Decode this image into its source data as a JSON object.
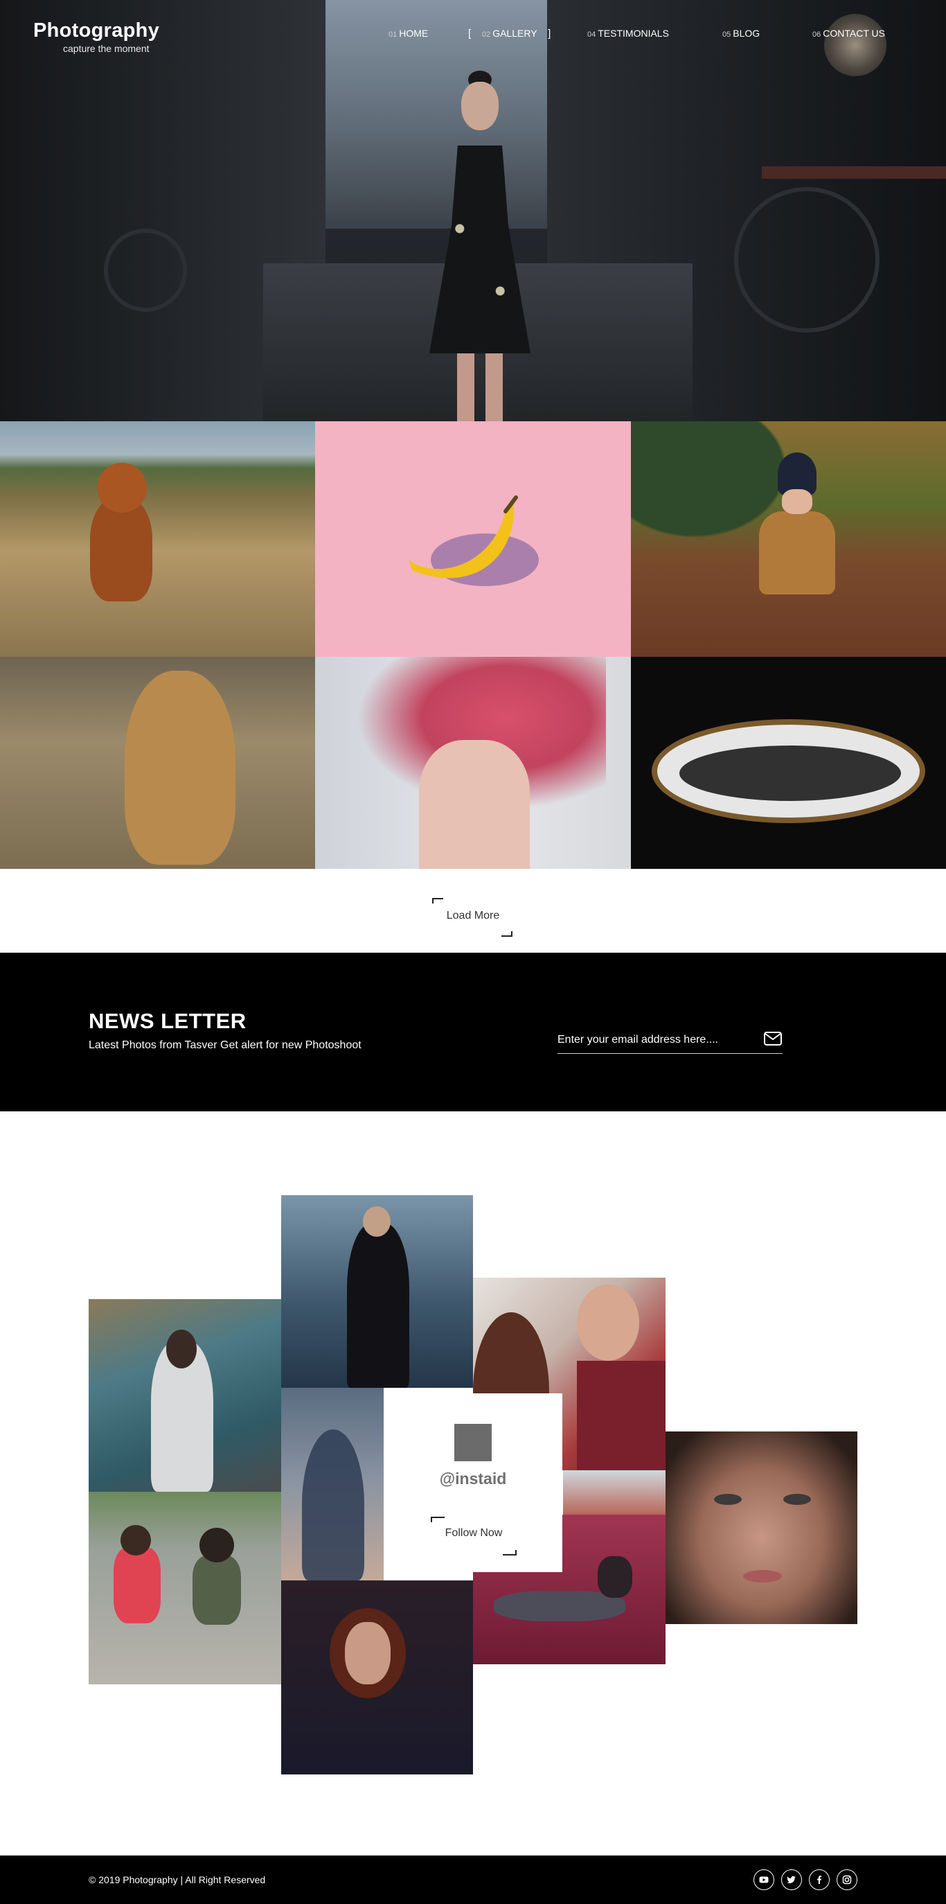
{
  "brand": {
    "title": "Photography",
    "tagline": "capture the moment"
  },
  "nav": {
    "items": [
      {
        "num": "01",
        "label": "HOME"
      },
      {
        "num": "02",
        "label": "GALLERY",
        "bracket_open": "[",
        "bracket_close": "]"
      },
      {
        "num": "04",
        "label": "TESTIMONIALS"
      },
      {
        "num": "05",
        "label": "BLOG"
      },
      {
        "num": "06",
        "label": "CONTACT US"
      }
    ]
  },
  "gallery": {
    "load_more": "Load More"
  },
  "newsletter": {
    "title": "NEWS LETTER",
    "subtitle": "Latest Photos from Tasver Get alert for new Photoshoot",
    "placeholder": "Enter your email address here....",
    "send_icon": "envelope-icon"
  },
  "instagram": {
    "handle": "@instaid",
    "follow_label": "Follow Now",
    "logo_icon": "instagram-logo-icon"
  },
  "footer": {
    "copyright": "© 2019 Photography | All Right Reserved",
    "socials": [
      "youtube-icon",
      "twitter-icon",
      "facebook-icon",
      "instagram-icon"
    ]
  },
  "colors": {
    "dark": "#000000",
    "white": "#ffffff",
    "hero_bg": "#23272c",
    "gallery_pink": "#f3b3c3",
    "insta_logo": "#6b6b6b"
  }
}
